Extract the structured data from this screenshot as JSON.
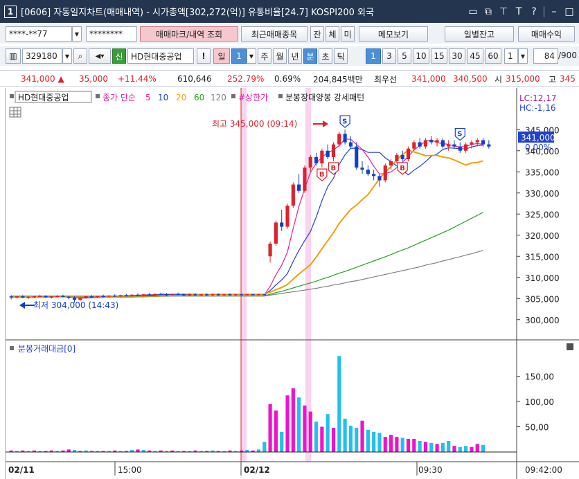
{
  "window": {
    "number": "1",
    "title": "[0606] 자동일지차트(매매내역) - 시가총액[302,272(억)] 유통비율[24.7] KOSPI200 외국",
    "icons": [
      "window-icon",
      "copy-icon",
      "pin-icon",
      "text-icon",
      "help-icon",
      "minimize-icon",
      "maximize-icon"
    ]
  },
  "toolbar1": {
    "account": "****-**77",
    "password": "********",
    "buttons": [
      "매매마크/내역 조회",
      "최근매매종목",
      "잔",
      "체",
      "미",
      "메모보기",
      "일별잔고",
      "매매수익"
    ]
  },
  "toolbar2": {
    "code": "329180",
    "badge": "신",
    "stock_name": "HD현대중공업",
    "alert": "!",
    "periods": [
      "일",
      "1",
      "주",
      "월",
      "년",
      "분",
      "초",
      "틱"
    ],
    "intervals": [
      "1",
      "3",
      "5",
      "10",
      "15",
      "30",
      "45",
      "60"
    ],
    "count_value": "1",
    "page_value": "84",
    "page_total": "/900"
  },
  "quote": {
    "price": "341,000 ▲",
    "change": "35,000",
    "change_pct": "+11.44%",
    "volume": "610,646",
    "volume_ratio": "252.79%",
    "turnover": "0.69%",
    "trade_amount": "204,845백만",
    "best_label": "최우선",
    "ask": "341,000",
    "bid": "340,500",
    "open_label": "시",
    "open": "315,000",
    "high_label": "고",
    "high": "345"
  },
  "legend": {
    "stock": "HD현대중공업",
    "ma_label": "종가 단순",
    "ma": [
      "5",
      "10",
      "20",
      "60",
      "120"
    ],
    "limit_label": "#상한가",
    "pattern_label": "분봉장대양봉 강세패턴",
    "ma_colors": [
      "#e0209c",
      "#2040d0",
      "#f0a000",
      "#20a020",
      "#808080"
    ]
  },
  "price_panel": {
    "lc": "LC:12,17",
    "hc": "HC:-1,16",
    "current_price": "341,000",
    "current_pct": "0,00%",
    "high_annotation": "최고 345,000 (09:14)",
    "low_annotation": "최저 304,000 (14:43)",
    "y_ticks": [
      "345,000",
      "340,000",
      "335,000",
      "330,000",
      "325,000",
      "320,000",
      "315,000",
      "310,000",
      "305,000",
      "300,000"
    ],
    "marker_labels": [
      "B",
      "B",
      "S",
      "B",
      "S"
    ]
  },
  "volume_panel": {
    "title": "분봉거래대금[0]",
    "y_ticks": [
      "150,00",
      "100,00",
      "50,00"
    ]
  },
  "x_axis": {
    "labels": [
      "02/11",
      "15:00",
      "02/12",
      "09:30",
      "09:42:00"
    ]
  },
  "chart_data": {
    "type": "candlestick",
    "ylim": [
      297500,
      347500
    ],
    "candles": [
      [
        305500,
        305800,
        304800,
        305300
      ],
      [
        305300,
        305600,
        305000,
        305500
      ],
      [
        305500,
        305800,
        305100,
        305200
      ],
      [
        305200,
        305500,
        304900,
        305400
      ],
      [
        305400,
        305700,
        305100,
        305500
      ],
      [
        305500,
        305900,
        305300,
        305600
      ],
      [
        305600,
        305800,
        305200,
        305300
      ],
      [
        305300,
        305600,
        305000,
        305500
      ],
      [
        305500,
        305800,
        305200,
        305600
      ],
      [
        305600,
        305900,
        305300,
        305400
      ],
      [
        305400,
        305700,
        304800,
        305200
      ],
      [
        305200,
        305500,
        304000,
        304700
      ],
      [
        304700,
        305300,
        304400,
        305200
      ],
      [
        305200,
        305600,
        305000,
        305500
      ],
      [
        305500,
        305800,
        305200,
        305400
      ],
      [
        305400,
        305700,
        305100,
        305600
      ],
      [
        305600,
        305900,
        305300,
        305500
      ],
      [
        305500,
        305800,
        305200,
        305700
      ],
      [
        305700,
        306000,
        305400,
        305600
      ],
      [
        305600,
        305900,
        305300,
        305800
      ],
      [
        305800,
        306100,
        305500,
        305700
      ],
      [
        305700,
        306000,
        305400,
        305900
      ],
      [
        305900,
        306200,
        305600,
        305800
      ],
      [
        305800,
        306100,
        305500,
        306000
      ],
      [
        306000,
        306300,
        305700,
        305900
      ],
      [
        305900,
        306200,
        305600,
        306100
      ],
      [
        306100,
        306400,
        305800,
        306000
      ],
      [
        306000,
        306300,
        305700,
        305900
      ],
      [
        305900,
        306200,
        305600,
        306100
      ],
      [
        306100,
        306400,
        305800,
        306000
      ],
      [
        306000,
        306200,
        305700,
        305900
      ],
      [
        305900,
        306200,
        305600,
        306000
      ],
      [
        306000,
        306300,
        305700,
        305900
      ],
      [
        305900,
        306100,
        305600,
        306000
      ],
      [
        306000,
        306200,
        305700,
        305900
      ],
      [
        305900,
        306200,
        305600,
        306000
      ],
      [
        306000,
        306200,
        305700,
        305900
      ],
      [
        305900,
        306100,
        305700,
        306000
      ],
      [
        306000,
        306200,
        305700,
        305900
      ],
      [
        305900,
        306100,
        305700,
        306000
      ],
      [
        306000,
        306100,
        305800,
        305900
      ],
      [
        305900,
        306100,
        305800,
        306000
      ],
      [
        306000,
        306100,
        305800,
        305900
      ],
      [
        305900,
        306100,
        305800,
        306000
      ],
      [
        306000,
        306100,
        305800,
        305900
      ],
      [
        315000,
        318500,
        313500,
        318000
      ],
      [
        318000,
        323500,
        317500,
        323000
      ],
      [
        323000,
        326000,
        321000,
        322000
      ],
      [
        322000,
        327500,
        321500,
        327000
      ],
      [
        327000,
        332500,
        326500,
        332000
      ],
      [
        332000,
        334500,
        330000,
        330500
      ],
      [
        330500,
        336500,
        330000,
        336000
      ],
      [
        336000,
        339000,
        335000,
        338500
      ],
      [
        338500,
        339500,
        336500,
        337000
      ],
      [
        337000,
        340500,
        336000,
        340000
      ],
      [
        340000,
        341500,
        338000,
        338500
      ],
      [
        338500,
        342000,
        337500,
        341500
      ],
      [
        341500,
        344500,
        341000,
        344000
      ],
      [
        344000,
        345000,
        341500,
        342000
      ],
      [
        342000,
        343500,
        340500,
        341000
      ],
      [
        341000,
        342000,
        335500,
        336000
      ],
      [
        336000,
        337500,
        334500,
        335500
      ],
      [
        335500,
        336500,
        334000,
        334500
      ],
      [
        334500,
        335500,
        333000,
        334000
      ],
      [
        334000,
        334500,
        331500,
        333000
      ],
      [
        333000,
        337000,
        332500,
        336500
      ],
      [
        336500,
        338000,
        335500,
        337500
      ],
      [
        337500,
        339500,
        337000,
        339000
      ],
      [
        339000,
        340000,
        337500,
        338000
      ],
      [
        338000,
        341000,
        337500,
        340500
      ],
      [
        340500,
        342500,
        340000,
        342000
      ],
      [
        342000,
        343000,
        340500,
        341000
      ],
      [
        341000,
        343000,
        340500,
        342500
      ],
      [
        342500,
        343500,
        341500,
        342000
      ],
      [
        342000,
        343000,
        341000,
        342500
      ],
      [
        342500,
        343000,
        340500,
        341000
      ],
      [
        341000,
        342500,
        340000,
        341500
      ],
      [
        341500,
        342500,
        340500,
        341000
      ],
      [
        341000,
        342000,
        339500,
        340000
      ],
      [
        340000,
        342000,
        339500,
        341500
      ],
      [
        341500,
        342500,
        340500,
        342000
      ],
      [
        342000,
        343000,
        341000,
        342500
      ],
      [
        342500,
        343000,
        341000,
        341500
      ],
      [
        341500,
        342500,
        340500,
        341000
      ]
    ],
    "ma_series": [
      {
        "name": "5",
        "color": "#e0209c",
        "values": [
          305300,
          305300,
          305300,
          305300,
          305300,
          305400,
          305400,
          305400,
          305400,
          305400,
          305300,
          305200,
          305100,
          305100,
          305200,
          305300,
          305500,
          305500,
          305500,
          305600,
          305700,
          305700,
          305800,
          305800,
          305900,
          305900,
          306000,
          306000,
          306000,
          306000,
          306000,
          306000,
          306000,
          306000,
          306000,
          305900,
          305900,
          305900,
          305900,
          305900,
          305900,
          305900,
          305900,
          305900,
          305900,
          307900,
          310600,
          312900,
          316000,
          321600,
          326800,
          331000,
          334900,
          337000,
          338500,
          339500,
          340200,
          341200,
          342800,
          342700,
          341500,
          340300,
          338500,
          336300,
          334500,
          334600,
          335000,
          336000,
          337300,
          338600,
          340200,
          341200,
          342200,
          342600,
          341900,
          341700,
          341500,
          341100,
          340900,
          341000,
          341500,
          341700,
          341500
        ]
      },
      {
        "name": "10",
        "color": "#2040d0",
        "values": [
          305300,
          305300,
          305300,
          305300,
          305300,
          305300,
          305400,
          305400,
          305400,
          305400,
          305400,
          305300,
          305200,
          305200,
          305200,
          305200,
          305200,
          305300,
          305400,
          305400,
          305500,
          305600,
          305600,
          305700,
          305800,
          305800,
          305900,
          305900,
          306000,
          306000,
          306000,
          306000,
          306000,
          306000,
          306000,
          306000,
          306000,
          306000,
          306000,
          306000,
          305900,
          305900,
          305900,
          305900,
          305900,
          306900,
          308200,
          309400,
          310900,
          313800,
          316400,
          318700,
          320900,
          324300,
          328200,
          331500,
          333500,
          336800,
          339000,
          340600,
          340600,
          340300,
          339600,
          339600,
          339600,
          338300,
          337400,
          336400,
          335300,
          334300,
          335400,
          336300,
          337400,
          338700,
          339200,
          340300,
          340700,
          340600,
          340500,
          340400,
          340900,
          341200,
          341300
        ]
      },
      {
        "name": "20",
        "color": "#f0a000",
        "values": [
          305300,
          305300,
          305300,
          305300,
          305300,
          305300,
          305300,
          305300,
          305400,
          305400,
          305400,
          305400,
          305400,
          305400,
          305400,
          305400,
          305300,
          305300,
          305300,
          305300,
          305300,
          305300,
          305400,
          305400,
          305500,
          305500,
          305600,
          305600,
          305700,
          305700,
          305800,
          305800,
          305900,
          305900,
          305900,
          306000,
          306000,
          306000,
          306000,
          306000,
          306000,
          306000,
          306000,
          306000,
          306000,
          306500,
          307100,
          307600,
          308300,
          309600,
          310800,
          311900,
          313000,
          314800,
          316800,
          318700,
          320600,
          322800,
          324500,
          326100,
          327100,
          328400,
          329600,
          331500,
          333400,
          335000,
          336200,
          337900,
          339100,
          340100,
          339700,
          339300,
          338800,
          338900,
          338900,
          338500,
          338300,
          337800,
          337200,
          336600,
          337100,
          337200,
          337600
        ]
      },
      {
        "name": "60",
        "color": "#20a020",
        "values": [
          305600,
          305600,
          305600,
          305600,
          305600,
          305600,
          305600,
          305600,
          305600,
          305600,
          305600,
          305600,
          305600,
          305600,
          305600,
          305600,
          305600,
          305600,
          305600,
          305600,
          305600,
          305600,
          305600,
          305600,
          305600,
          305600,
          305600,
          305600,
          305600,
          305600,
          305600,
          305600,
          305600,
          305600,
          305600,
          305600,
          305600,
          305600,
          305600,
          305600,
          305600,
          305600,
          305600,
          305600,
          305600,
          306000,
          306400,
          306700,
          307100,
          307500,
          307900,
          308300,
          308700,
          309100,
          309600,
          310000,
          310500,
          311000,
          311400,
          311900,
          312400,
          312900,
          313400,
          313900,
          314400,
          314900,
          315400,
          316000,
          316500,
          317000,
          317600,
          318200,
          318800,
          319400,
          320000,
          320600,
          321200,
          321900,
          322600,
          323300,
          324000,
          324700,
          325400
        ]
      },
      {
        "name": "120",
        "color": "#808080",
        "values": [
          305600,
          305600,
          305600,
          305600,
          305600,
          305600,
          305600,
          305600,
          305600,
          305600,
          305600,
          305600,
          305600,
          305600,
          305600,
          305600,
          305600,
          305600,
          305600,
          305600,
          305600,
          305600,
          305600,
          305600,
          305600,
          305600,
          305600,
          305600,
          305600,
          305600,
          305600,
          305600,
          305600,
          305600,
          305600,
          305600,
          305600,
          305600,
          305600,
          305600,
          305600,
          305600,
          305600,
          305600,
          305600,
          305800,
          306000,
          306200,
          306400,
          306600,
          306800,
          307000,
          307200,
          307400,
          307700,
          307900,
          308200,
          308400,
          308700,
          309000,
          309200,
          309500,
          309800,
          310100,
          310400,
          310700,
          311000,
          311300,
          311600,
          311900,
          312200,
          312500,
          312900,
          313200,
          313500,
          313900,
          314200,
          314600,
          314900,
          315300,
          315600,
          316000,
          316400
        ]
      }
    ],
    "volume_ylim": [
      0,
      200
    ],
    "volume": [
      3,
      2,
      3,
      2,
      3,
      2,
      2,
      3,
      2,
      3,
      5,
      4,
      2,
      3,
      2,
      2,
      2,
      2,
      3,
      2,
      2,
      4,
      5,
      4,
      3,
      2,
      3,
      2,
      3,
      2,
      2,
      2,
      3,
      2,
      2,
      3,
      2,
      2,
      3,
      2,
      3,
      4,
      3,
      5,
      20,
      95,
      82,
      40,
      112,
      126,
      108,
      92,
      80,
      60,
      50,
      75,
      48,
      190,
      66,
      52,
      48,
      62,
      44,
      40,
      38,
      30,
      34,
      30,
      28,
      26,
      26,
      22,
      20,
      18,
      16,
      18,
      22,
      12,
      10,
      12,
      10,
      16,
      14
    ],
    "volume_colors": [
      "up",
      "down",
      "up",
      "down",
      "up",
      "down",
      "up",
      "up",
      "down",
      "up",
      "up",
      "down",
      "up",
      "down",
      "up",
      "down",
      "up",
      "down",
      "up",
      "down",
      "up",
      "down",
      "up",
      "down",
      "up",
      "down",
      "up",
      "down",
      "up",
      "down",
      "up",
      "down",
      "up",
      "down",
      "up",
      "down",
      "up",
      "down",
      "up",
      "down",
      "up",
      "down",
      "up",
      "down",
      "down",
      "up",
      "up",
      "down",
      "up",
      "up",
      "down",
      "up",
      "up",
      "down",
      "up",
      "down",
      "up",
      "down",
      "down",
      "down",
      "down",
      "up",
      "down",
      "down",
      "down",
      "up",
      "up",
      "up",
      "down",
      "up",
      "up",
      "down",
      "up",
      "down",
      "up",
      "down",
      "down",
      "up",
      "down",
      "down",
      "up",
      "up",
      "down"
    ]
  }
}
